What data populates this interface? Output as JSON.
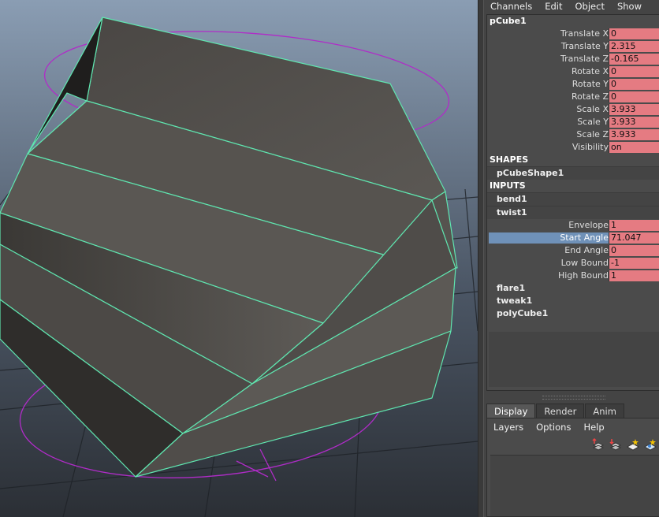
{
  "channel_menu": [
    "Channels",
    "Edit",
    "Object",
    "Show"
  ],
  "object_name": "pCube1",
  "transform_attrs": [
    {
      "label": "Translate X",
      "value": "0"
    },
    {
      "label": "Translate Y",
      "value": "2.315"
    },
    {
      "label": "Translate Z",
      "value": "-0.165"
    },
    {
      "label": "Rotate X",
      "value": "0"
    },
    {
      "label": "Rotate Y",
      "value": "0"
    },
    {
      "label": "Rotate Z",
      "value": "0"
    },
    {
      "label": "Scale X",
      "value": "3.933"
    },
    {
      "label": "Scale Y",
      "value": "3.933"
    },
    {
      "label": "Scale Z",
      "value": "3.933"
    },
    {
      "label": "Visibility",
      "value": "on"
    }
  ],
  "shapes_header": "SHAPES",
  "shape_node": "pCubeShape1",
  "inputs_header": "INPUTS",
  "inputs": [
    "bend1",
    "twist1",
    "flare1",
    "tweak1",
    "polyCube1"
  ],
  "twist_attrs": [
    {
      "label": "Envelope",
      "value": "1"
    },
    {
      "label": "Start Angle",
      "value": "71.047"
    },
    {
      "label": "End Angle",
      "value": "0"
    },
    {
      "label": "Low Bound",
      "value": "-1"
    },
    {
      "label": "High Bound",
      "value": "1"
    }
  ],
  "layer_tabs": [
    "Display",
    "Render",
    "Anim"
  ],
  "layer_menu": [
    "Layers",
    "Options",
    "Help"
  ],
  "colors": {
    "attr_value_bg": "#e57b82",
    "selected_attr": "#6f91b8",
    "wire": "#5fe6b0",
    "deformer_handle": "#b02cc8"
  }
}
